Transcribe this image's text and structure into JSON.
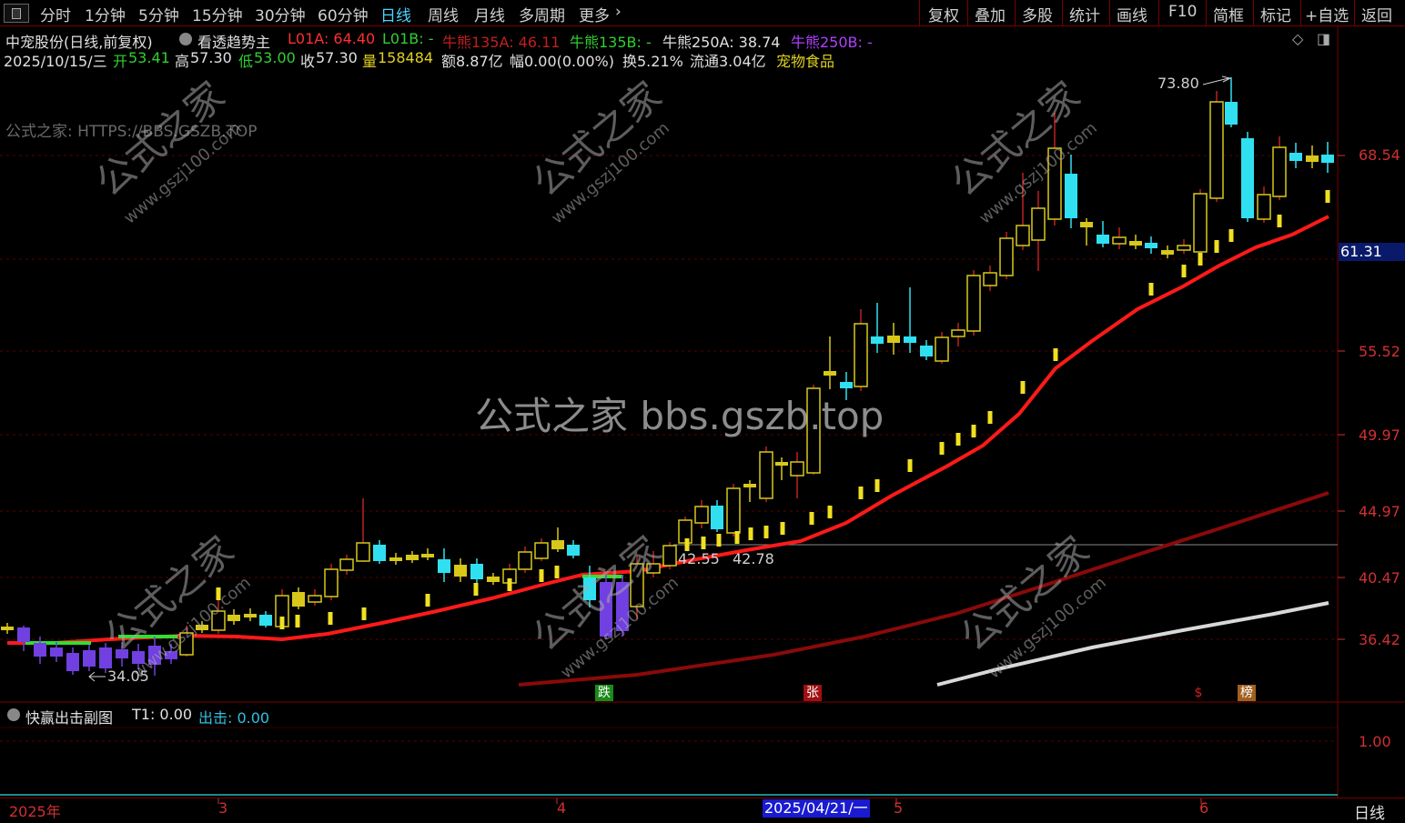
{
  "toolbar": {
    "left_items": [
      "分时",
      "1分钟",
      "5分钟",
      "15分钟",
      "30分钟",
      "60分钟",
      "日线",
      "周线",
      "月线",
      "多周期",
      "更多"
    ],
    "active": "日线",
    "right_items": [
      "复权",
      "叠加",
      "多股",
      "统计",
      "画线",
      "F10",
      "简框",
      "标记",
      "+自选",
      "返回"
    ]
  },
  "header": {
    "stock_name": "中宠股份(日线,前复权)",
    "indicator_name": "看透趋势主",
    "l01a": "L01A: 64.40",
    "l01b": "L01B: -",
    "nx135a": "牛熊135A: 46.11",
    "nx135b": "牛熊135B: -",
    "nx250a": "牛熊250A: 38.74",
    "nx250b": "牛熊250B: -",
    "date": "2025/10/15/三",
    "open_label": "开",
    "open": "53.41",
    "high_label": "高",
    "high": "57.30",
    "low_label": "低",
    "low": "53.00",
    "close_label": "收",
    "close": "57.30",
    "vol_label": "量",
    "vol": "158484",
    "amount": "额8.87亿",
    "range": "幅0.00(0.00%)",
    "turnover": "换5.21%",
    "float": "流通3.04亿",
    "sector": "宠物食品"
  },
  "watermark_url": "公式之家: HTTPS://BBS.GSZB.TOP",
  "center_watermark": "公式之家 bbs.gszb.top",
  "site_watermark": "公式之家",
  "site_url_watermark": "www.gszj100.com",
  "price_axis": {
    "labels": [
      "68.54",
      "55.52",
      "49.97",
      "44.97",
      "40.47",
      "36.42"
    ],
    "current_tag": "61.31"
  },
  "chart_data": {
    "type": "candlestick",
    "annotations": {
      "max": "73.80",
      "min": "34.05",
      "lvl1": "42.55",
      "lvl2": "42.78"
    },
    "signals": [
      {
        "text": "跌",
        "color": "#1a8a1a"
      },
      {
        "text": "张",
        "color": "#a01010"
      },
      {
        "text": "$",
        "color": "#a01010"
      },
      {
        "text": "榜",
        "color": "#a06020"
      }
    ],
    "series": [
      {
        "name": "L01A",
        "color": "#ff1a1a"
      },
      {
        "name": "牛熊135A",
        "color": "#8a0a0a"
      },
      {
        "name": "牛熊250A",
        "color": "#cccccc"
      }
    ]
  },
  "sub_pane": {
    "name": "快赢出击副图",
    "t1": "T1: 0.00",
    "out_label": "出击: 0.00",
    "axis_label": "1.00"
  },
  "date_axis": {
    "labels": [
      "2025年",
      "3",
      "4",
      "5",
      "6"
    ],
    "cursor_date": "2025/04/21/一",
    "period": "日线"
  },
  "colors": {
    "up": "#d8c81a",
    "down": "#30e0f0",
    "bg": "#000000",
    "axis": "#7a0000"
  }
}
